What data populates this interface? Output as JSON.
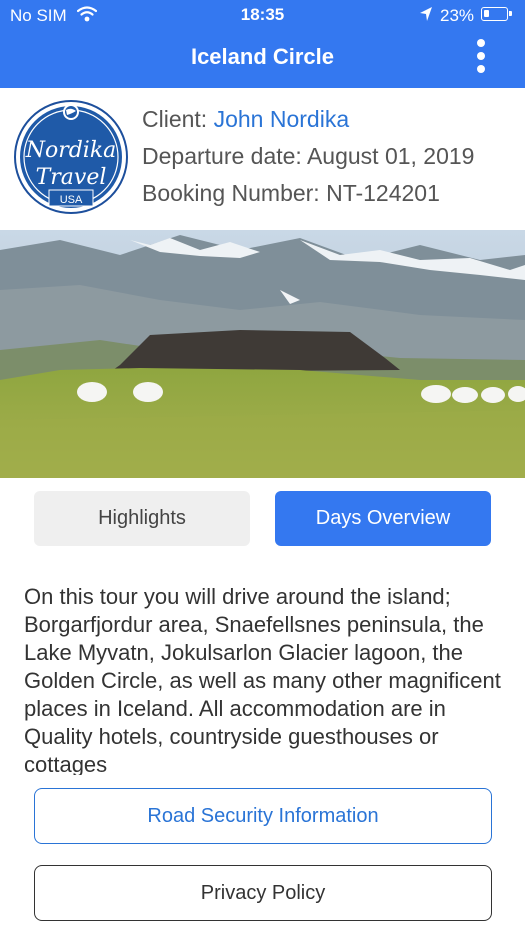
{
  "status_bar": {
    "carrier": "No SIM",
    "time": "18:35",
    "battery": "23%"
  },
  "nav": {
    "title": "Iceland Circle"
  },
  "logo": {
    "line1": "Nordika",
    "line2": "Travel",
    "line3": "USA"
  },
  "booking": {
    "client_label": "Client: ",
    "client_name": "John Nordika",
    "departure_label": "Departure date: ",
    "departure_value": "August 01, 2019",
    "booking_label": "Booking Number: ",
    "booking_value": "NT-124201"
  },
  "tabs": [
    {
      "label": "Highlights",
      "selected": false
    },
    {
      "label": "Days Overview",
      "selected": true
    }
  ],
  "description": "On this tour you will drive around the island; Borgarfjordur area, Snaefellsnes peninsula, the Lake Myvatn, Jokulsarlon Glacier lagoon, the Golden Circle, as well as many other magnificent places in Iceland. All accommodation are in Quality hotels, countryside guesthouses or cottages",
  "buttons": {
    "road_security": "Road Security Information",
    "privacy": "Privacy Policy"
  },
  "colors": {
    "accent": "#3478f0",
    "link": "#2a74d6",
    "tab_inactive": "#efefef"
  }
}
